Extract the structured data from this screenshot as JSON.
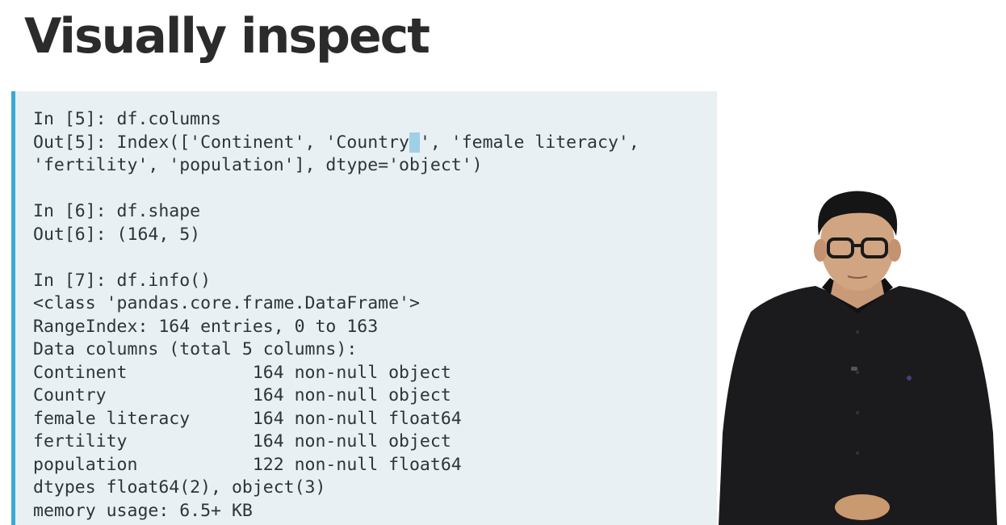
{
  "slide": {
    "title": "Visually inspect"
  },
  "code": {
    "lines": [
      "In [5]: df.columns",
      "Out[5]: Index(['Continent', 'Country ', 'female literacy',",
      "'fertility', 'population'], dtype='object')",
      "",
      "In [6]: df.shape",
      "Out[6]: (164, 5)",
      "",
      "In [7]: df.info()",
      "<class 'pandas.core.frame.DataFrame'>",
      "RangeIndex: 164 entries, 0 to 163",
      "Data columns (total 5 columns):",
      "Continent            164 non-null object",
      "Country              164 non-null object",
      "female literacy      164 non-null float64",
      "fertility            164 non-null object",
      "population           122 non-null float64",
      "dtypes float64(2), object(3)",
      "memory usage: 6.5+ KB"
    ]
  },
  "colors": {
    "panel_background": "#e8f0f4",
    "panel_accent": "#3aa9d3",
    "highlight": "#9fd0e6"
  }
}
